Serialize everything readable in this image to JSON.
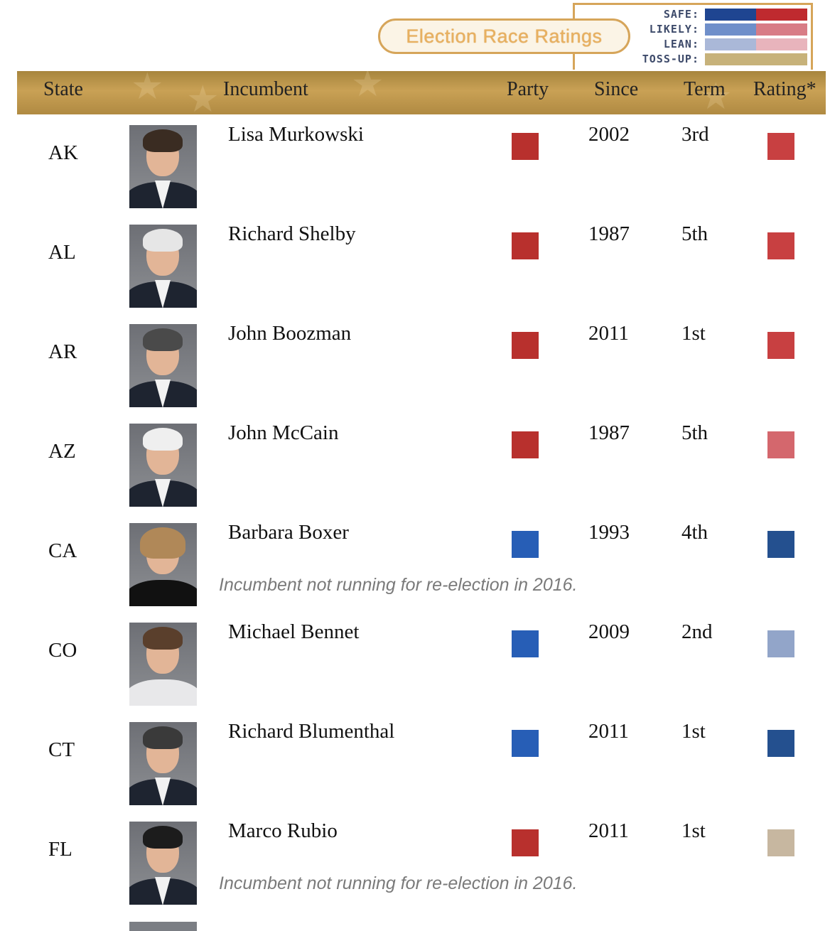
{
  "legend": {
    "title": "Election Race Ratings",
    "rows": [
      {
        "label": "SAFE:",
        "dem_color": "#1f4591",
        "rep_color": "#bf2a2f"
      },
      {
        "label": "LIKELY:",
        "dem_color": "#6f8fca",
        "rep_color": "#d87c86"
      },
      {
        "label": "LEAN:",
        "dem_color": "#aab8d8",
        "rep_color": "#e8b4bc"
      },
      {
        "label": "TOSS-UP:",
        "color": "#c7b27a"
      }
    ]
  },
  "header": {
    "state": "State",
    "incumbent": "Incumbent",
    "party": "Party",
    "since": "Since",
    "term": "Term",
    "rating": "Rating*"
  },
  "rows": [
    {
      "state": "AK",
      "name": "Lisa Murkowski",
      "party_color": "#b8302d",
      "since": "2002",
      "term": "3rd",
      "rating_color": "#c84041",
      "note": ""
    },
    {
      "state": "AL",
      "name": "Richard Shelby",
      "party_color": "#b8302d",
      "since": "1987",
      "term": "5th",
      "rating_color": "#c84041",
      "note": ""
    },
    {
      "state": "AR",
      "name": "John Boozman",
      "party_color": "#b8302d",
      "since": "2011",
      "term": "1st",
      "rating_color": "#c84041",
      "note": ""
    },
    {
      "state": "AZ",
      "name": "John McCain",
      "party_color": "#b8302d",
      "since": "1987",
      "term": "5th",
      "rating_color": "#d4676d",
      "note": ""
    },
    {
      "state": "CA",
      "name": "Barbara Boxer",
      "party_color": "#275eb6",
      "since": "1993",
      "term": "4th",
      "rating_color": "#24508f",
      "note": "Incumbent not running for re-election in 2016."
    },
    {
      "state": "CO",
      "name": "Michael Bennet",
      "party_color": "#275eb6",
      "since": "2009",
      "term": "2nd",
      "rating_color": "#92a5c9",
      "note": ""
    },
    {
      "state": "CT",
      "name": "Richard Blumenthal",
      "party_color": "#275eb6",
      "since": "2011",
      "term": "1st",
      "rating_color": "#24508f",
      "note": ""
    },
    {
      "state": "FL",
      "name": "Marco Rubio",
      "party_color": "#b8302d",
      "since": "2011",
      "term": "1st",
      "rating_color": "#c7b7a0",
      "note": "Incumbent not running for re-election in 2016."
    }
  ]
}
